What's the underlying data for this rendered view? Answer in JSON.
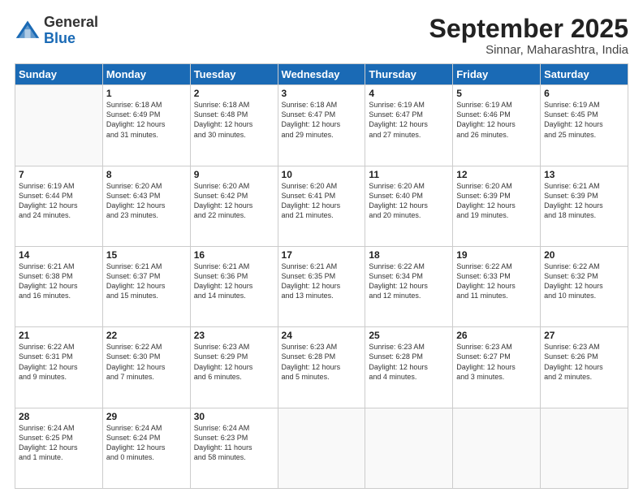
{
  "header": {
    "logo_general": "General",
    "logo_blue": "Blue",
    "month_title": "September 2025",
    "location": "Sinnar, Maharashtra, India"
  },
  "weekdays": [
    "Sunday",
    "Monday",
    "Tuesday",
    "Wednesday",
    "Thursday",
    "Friday",
    "Saturday"
  ],
  "weeks": [
    [
      {
        "day": "",
        "info": ""
      },
      {
        "day": "1",
        "info": "Sunrise: 6:18 AM\nSunset: 6:49 PM\nDaylight: 12 hours\nand 31 minutes."
      },
      {
        "day": "2",
        "info": "Sunrise: 6:18 AM\nSunset: 6:48 PM\nDaylight: 12 hours\nand 30 minutes."
      },
      {
        "day": "3",
        "info": "Sunrise: 6:18 AM\nSunset: 6:47 PM\nDaylight: 12 hours\nand 29 minutes."
      },
      {
        "day": "4",
        "info": "Sunrise: 6:19 AM\nSunset: 6:47 PM\nDaylight: 12 hours\nand 27 minutes."
      },
      {
        "day": "5",
        "info": "Sunrise: 6:19 AM\nSunset: 6:46 PM\nDaylight: 12 hours\nand 26 minutes."
      },
      {
        "day": "6",
        "info": "Sunrise: 6:19 AM\nSunset: 6:45 PM\nDaylight: 12 hours\nand 25 minutes."
      }
    ],
    [
      {
        "day": "7",
        "info": "Sunrise: 6:19 AM\nSunset: 6:44 PM\nDaylight: 12 hours\nand 24 minutes."
      },
      {
        "day": "8",
        "info": "Sunrise: 6:20 AM\nSunset: 6:43 PM\nDaylight: 12 hours\nand 23 minutes."
      },
      {
        "day": "9",
        "info": "Sunrise: 6:20 AM\nSunset: 6:42 PM\nDaylight: 12 hours\nand 22 minutes."
      },
      {
        "day": "10",
        "info": "Sunrise: 6:20 AM\nSunset: 6:41 PM\nDaylight: 12 hours\nand 21 minutes."
      },
      {
        "day": "11",
        "info": "Sunrise: 6:20 AM\nSunset: 6:40 PM\nDaylight: 12 hours\nand 20 minutes."
      },
      {
        "day": "12",
        "info": "Sunrise: 6:20 AM\nSunset: 6:39 PM\nDaylight: 12 hours\nand 19 minutes."
      },
      {
        "day": "13",
        "info": "Sunrise: 6:21 AM\nSunset: 6:39 PM\nDaylight: 12 hours\nand 18 minutes."
      }
    ],
    [
      {
        "day": "14",
        "info": "Sunrise: 6:21 AM\nSunset: 6:38 PM\nDaylight: 12 hours\nand 16 minutes."
      },
      {
        "day": "15",
        "info": "Sunrise: 6:21 AM\nSunset: 6:37 PM\nDaylight: 12 hours\nand 15 minutes."
      },
      {
        "day": "16",
        "info": "Sunrise: 6:21 AM\nSunset: 6:36 PM\nDaylight: 12 hours\nand 14 minutes."
      },
      {
        "day": "17",
        "info": "Sunrise: 6:21 AM\nSunset: 6:35 PM\nDaylight: 12 hours\nand 13 minutes."
      },
      {
        "day": "18",
        "info": "Sunrise: 6:22 AM\nSunset: 6:34 PM\nDaylight: 12 hours\nand 12 minutes."
      },
      {
        "day": "19",
        "info": "Sunrise: 6:22 AM\nSunset: 6:33 PM\nDaylight: 12 hours\nand 11 minutes."
      },
      {
        "day": "20",
        "info": "Sunrise: 6:22 AM\nSunset: 6:32 PM\nDaylight: 12 hours\nand 10 minutes."
      }
    ],
    [
      {
        "day": "21",
        "info": "Sunrise: 6:22 AM\nSunset: 6:31 PM\nDaylight: 12 hours\nand 9 minutes."
      },
      {
        "day": "22",
        "info": "Sunrise: 6:22 AM\nSunset: 6:30 PM\nDaylight: 12 hours\nand 7 minutes."
      },
      {
        "day": "23",
        "info": "Sunrise: 6:23 AM\nSunset: 6:29 PM\nDaylight: 12 hours\nand 6 minutes."
      },
      {
        "day": "24",
        "info": "Sunrise: 6:23 AM\nSunset: 6:28 PM\nDaylight: 12 hours\nand 5 minutes."
      },
      {
        "day": "25",
        "info": "Sunrise: 6:23 AM\nSunset: 6:28 PM\nDaylight: 12 hours\nand 4 minutes."
      },
      {
        "day": "26",
        "info": "Sunrise: 6:23 AM\nSunset: 6:27 PM\nDaylight: 12 hours\nand 3 minutes."
      },
      {
        "day": "27",
        "info": "Sunrise: 6:23 AM\nSunset: 6:26 PM\nDaylight: 12 hours\nand 2 minutes."
      }
    ],
    [
      {
        "day": "28",
        "info": "Sunrise: 6:24 AM\nSunset: 6:25 PM\nDaylight: 12 hours\nand 1 minute."
      },
      {
        "day": "29",
        "info": "Sunrise: 6:24 AM\nSunset: 6:24 PM\nDaylight: 12 hours\nand 0 minutes."
      },
      {
        "day": "30",
        "info": "Sunrise: 6:24 AM\nSunset: 6:23 PM\nDaylight: 11 hours\nand 58 minutes."
      },
      {
        "day": "",
        "info": ""
      },
      {
        "day": "",
        "info": ""
      },
      {
        "day": "",
        "info": ""
      },
      {
        "day": "",
        "info": ""
      }
    ]
  ]
}
